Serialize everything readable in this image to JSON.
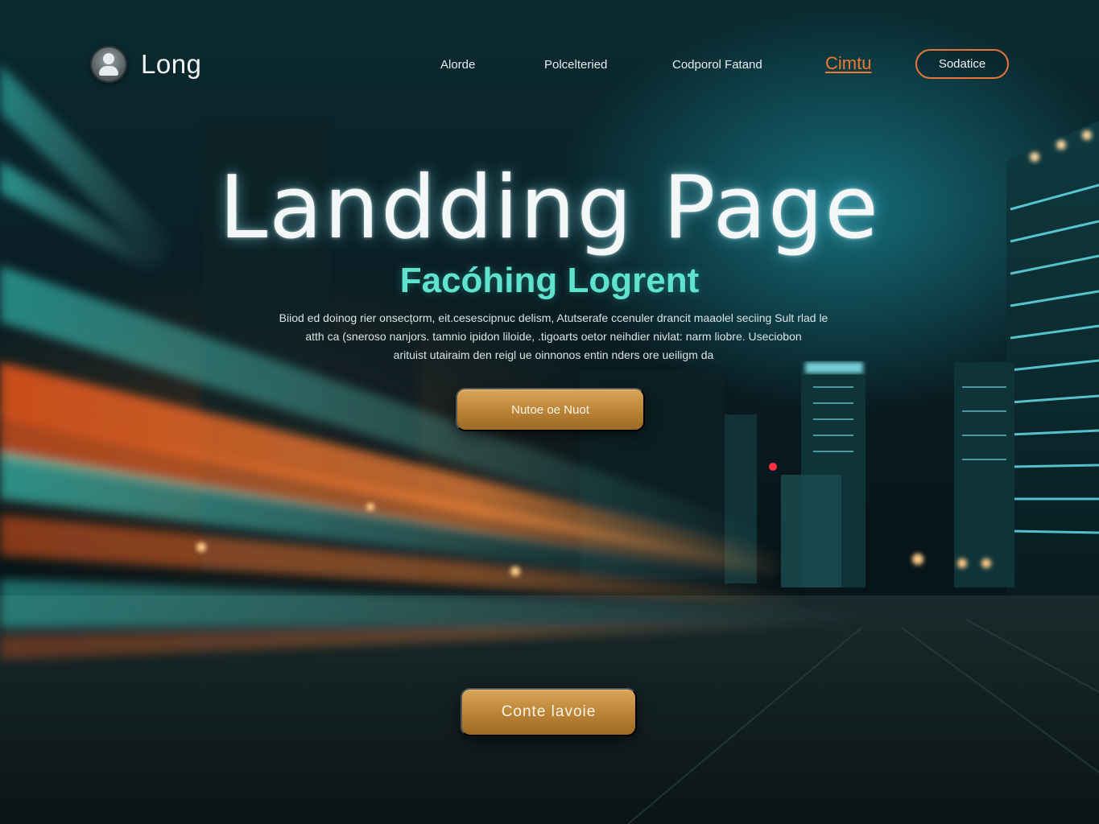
{
  "brand": {
    "name": "Long",
    "icon": "user-avatar-icon"
  },
  "nav": {
    "links": [
      "Alorde",
      "Polcelteried",
      "Codporol Fatand"
    ],
    "accent_link": "Cimtu",
    "cta_label": "Sodatice"
  },
  "hero": {
    "title": "Landding Page",
    "subtitle": "Facóhing Logrent",
    "body_lines": [
      "Biiod ed  doinog rier  onsecțorm, eit.cesescipnuc delism,  Atutserafe ccenuler drancit maaolel seciing Sult rlad le",
      "atth ca (sneroso nanjors. tamnio ipidon liloide, .tigoarts oetor neihdier nivlat:  narm liobre. Useciobon",
      "arituist utairaim den reigl ue oinnonos entin nders ore ueiligm da"
    ],
    "primary_button": "Nutoe oe Nuot",
    "secondary_button": "Conte lavoie"
  },
  "colors": {
    "accent_orange": "#e8743a",
    "accent_teal": "#5fe3cf",
    "button_gold": "#c08a3c",
    "background": "#071418"
  }
}
